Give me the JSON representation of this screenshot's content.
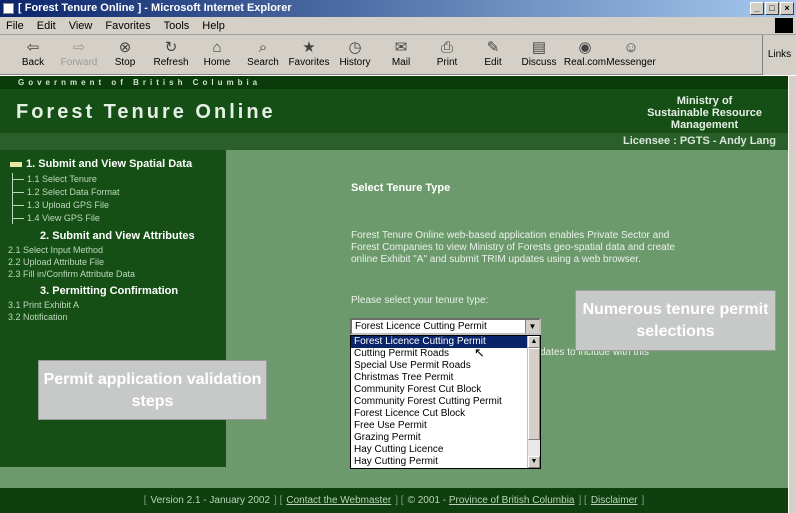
{
  "window": {
    "title": "[ Forest Tenure Online ] - Microsoft Internet Explorer",
    "controls": [
      "_",
      "□",
      "×"
    ]
  },
  "menu": [
    "File",
    "Edit",
    "View",
    "Favorites",
    "Tools",
    "Help"
  ],
  "toolbar": {
    "buttons": [
      {
        "label": "Back",
        "icon": "back-arrow-icon",
        "glyph": "⇦"
      },
      {
        "label": "Forward",
        "icon": "forward-arrow-icon",
        "glyph": "⇨"
      },
      {
        "label": "Stop",
        "icon": "stop-icon",
        "glyph": "⊗"
      },
      {
        "label": "Refresh",
        "icon": "refresh-icon",
        "glyph": "↻"
      },
      {
        "label": "Home",
        "icon": "home-icon",
        "glyph": "⌂"
      },
      {
        "label": "Search",
        "icon": "search-icon",
        "glyph": "⌕"
      },
      {
        "label": "Favorites",
        "icon": "favorites-icon",
        "glyph": "★"
      },
      {
        "label": "History",
        "icon": "history-icon",
        "glyph": "◷"
      },
      {
        "label": "Mail",
        "icon": "mail-icon",
        "glyph": "✉"
      },
      {
        "label": "Print",
        "icon": "print-icon",
        "glyph": "⎙"
      },
      {
        "label": "Edit",
        "icon": "edit-icon",
        "glyph": "✎"
      },
      {
        "label": "Discuss",
        "icon": "discuss-icon",
        "glyph": "▤"
      },
      {
        "label": "Real.com",
        "icon": "realcom-icon",
        "glyph": "◉"
      },
      {
        "label": "Messenger",
        "icon": "messenger-icon",
        "glyph": "☺"
      }
    ],
    "links_label": "Links"
  },
  "header": {
    "gov_strip": "Government of British Columbia",
    "site_title": "Forest Tenure Online",
    "ministry_line1": "Ministry of",
    "ministry_line2": "Sustainable Resource",
    "ministry_line3": "Management",
    "licensee": "Licensee : PGTS - Andy Lang"
  },
  "sidebar": {
    "section1": "1. Submit and View Spatial Data",
    "section1_steps": [
      "1.1 Select Tenure",
      "1.2 Select Data Format",
      "1.3 Upload GPS File",
      "1.4 View GPS File"
    ],
    "section2": "2. Submit and View Attributes",
    "section2_steps": [
      "2.1 Select Input Method",
      "2.2 Upload Attribute File",
      "2.3 Fill in/Confirm Attribute Data"
    ],
    "section3": "3. Permitting Confirmation",
    "section3_steps": [
      "3.1 Print Exhibit A",
      "3.2 Notification"
    ]
  },
  "main": {
    "title": "Select Tenure Type",
    "intro": "Forest Tenure Online web-based application enables Private Sector and Forest Companies to view Ministry of Forests geo-spatial data and create online Exhibit \"A\" and submit TRIM updates using a web browser.",
    "prompt": "Please select your tenure type:",
    "partial_text": "dates to include with this",
    "select_value": "Forest Licence Cutting Permit",
    "options": [
      "Forest Licence Cutting Permit",
      "Cutting Permit Roads",
      "Special Use Permit Roads",
      "Christmas Tree Permit",
      "Community Forest Cut Block",
      "Community Forest Cutting Permit",
      "Forest Licence Cut Block",
      "Free Use Permit",
      "Grazing Permit",
      "Hay Cutting Licence",
      "Hay Cutting Permit"
    ],
    "selected_index": 0
  },
  "callouts": {
    "left": "Permit application validation steps",
    "right": "Numerous tenure permit selections"
  },
  "footer": {
    "version": "Version 2.1 - January 2002",
    "contact": "Contact the Webmaster",
    "copyright_prefix": "© 2001 -",
    "province": "Province of British Columbia",
    "disclaimer": "Disclaimer"
  }
}
